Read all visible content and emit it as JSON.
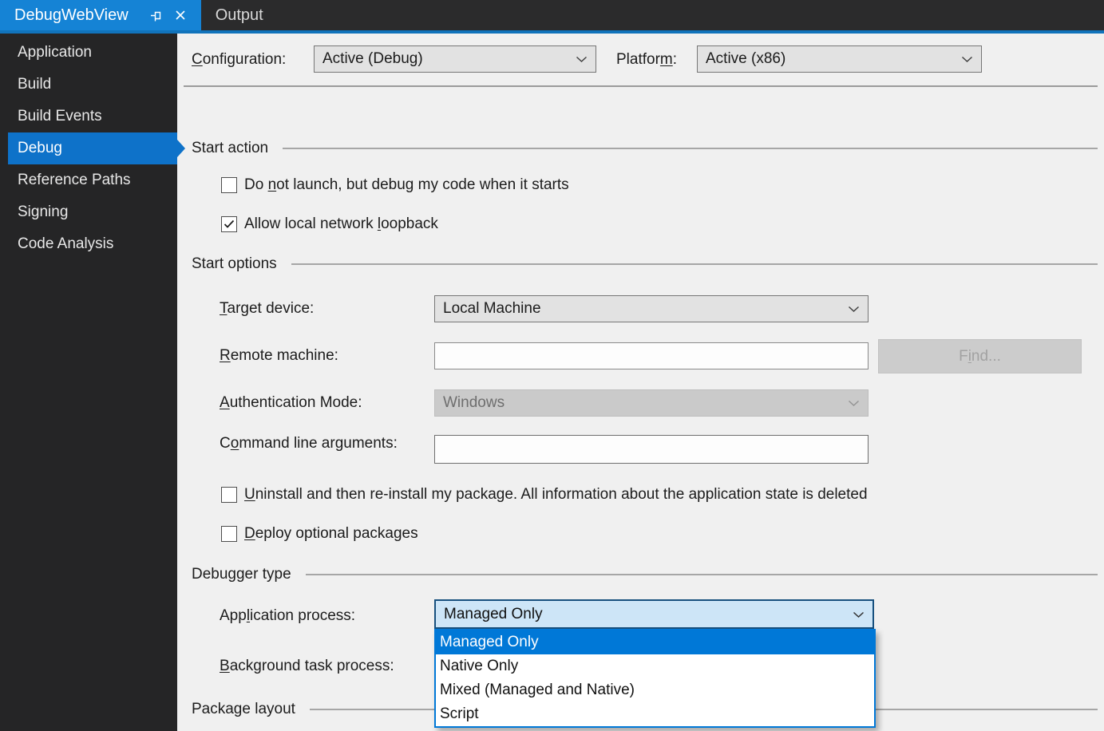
{
  "colors": {
    "accent_blue": "#0078d7",
    "active_tab_blue": "#1583d5",
    "tab_strip_blue": "#1173bb",
    "sidebar_bg": "#252526",
    "sidebar_selected_blue": "#0e72c9",
    "open_combo_bg": "#cde5f7",
    "open_combo_border": "#17507e",
    "page_bg": "#f0f0f0"
  },
  "icons": {
    "pin-icon": "pushpin outline (docked tab)",
    "close-icon": "✕",
    "chevron-down-icon": "⌄",
    "checkmark-icon": "✓",
    "selected-arrow": "▶"
  },
  "tab_bar": {
    "active_tab": "DebugWebView",
    "inactive_tab": "Output"
  },
  "sidebar": {
    "items": [
      {
        "label": "Application",
        "selected": false
      },
      {
        "label": "Build",
        "selected": false
      },
      {
        "label": "Build Events",
        "selected": false
      },
      {
        "label": "Debug",
        "selected": true
      },
      {
        "label": "Reference Paths",
        "selected": false
      },
      {
        "label": "Signing",
        "selected": false
      },
      {
        "label": "Code Analysis",
        "selected": false
      }
    ]
  },
  "config_bar": {
    "configuration_label": {
      "pre": "",
      "accel": "C",
      "post": "onfiguration:"
    },
    "configuration_value": "Active (Debug)",
    "platform_label": {
      "pre": "Platfor",
      "accel": "m",
      "post": ":"
    },
    "platform_value": "Active (x86)"
  },
  "start_action": {
    "header": "Start action",
    "do_not_launch": {
      "checked": false,
      "label": {
        "pre": "Do ",
        "accel": "n",
        "post": "ot launch, but debug my code when it starts"
      }
    },
    "allow_loopback": {
      "checked": true,
      "label": {
        "pre": "Allow local network ",
        "accel": "l",
        "post": "oopback"
      }
    }
  },
  "start_options": {
    "header": "Start options",
    "target_device": {
      "label": {
        "pre": "",
        "accel": "T",
        "post": "arget device:"
      },
      "value": "Local Machine"
    },
    "remote_machine": {
      "label": {
        "pre": "",
        "accel": "R",
        "post": "emote machine:"
      },
      "value": ""
    },
    "find_button": {
      "enabled": false,
      "label": {
        "pre": "F",
        "accel": "i",
        "post": "nd..."
      }
    },
    "authentication_mode": {
      "enabled": false,
      "label": {
        "pre": "",
        "accel": "A",
        "post": "uthentication Mode:"
      },
      "value": "Windows"
    },
    "command_line_arguments": {
      "label": {
        "pre": "C",
        "accel": "o",
        "post": "mmand line arguments:"
      },
      "value": ""
    },
    "uninstall_reinstall": {
      "checked": false,
      "label": {
        "pre": "",
        "accel": "U",
        "post": "ninstall and then re-install my package. All information about the application state is deleted"
      }
    },
    "deploy_optional": {
      "checked": false,
      "label": {
        "pre": "",
        "accel": "D",
        "post": "eploy optional packages"
      }
    }
  },
  "debugger_type": {
    "header": "Debugger type",
    "application_process": {
      "open": true,
      "label": {
        "pre": "App",
        "accel": "l",
        "post": "ication process:"
      },
      "value": "Managed Only"
    },
    "dropdown": {
      "highlighted_index": 0,
      "options": [
        "Managed Only",
        "Native Only",
        "Mixed (Managed and Native)",
        "Script"
      ]
    },
    "background_task_process": {
      "label": {
        "pre": "",
        "accel": "B",
        "post": "ackground task process:"
      }
    }
  },
  "package_layout": {
    "header": "Package layout"
  }
}
